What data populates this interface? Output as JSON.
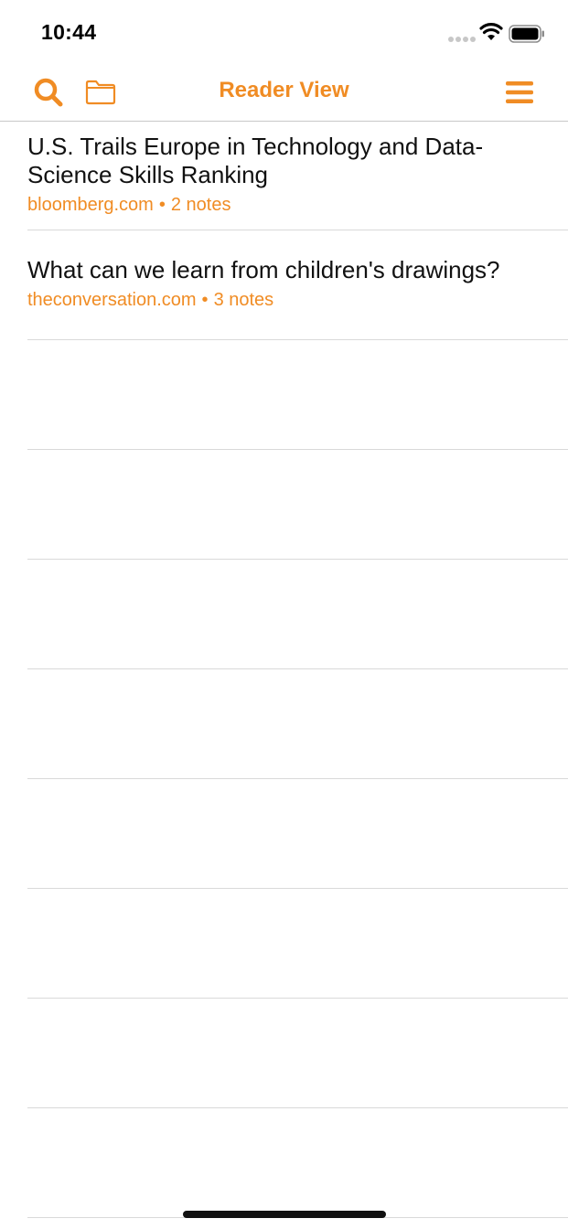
{
  "status_bar": {
    "time": "10:44"
  },
  "nav": {
    "title": "Reader View",
    "accent_color": "#f08c24",
    "left_icons": [
      "search-icon",
      "folder-icon"
    ],
    "right_icons": [
      "menu-icon"
    ]
  },
  "articles": [
    {
      "title": "U.S. Trails Europe in Technology and Data-Science Skills Ranking",
      "source": "bloomberg.com",
      "separator": "•",
      "notes": "2 notes"
    },
    {
      "title": "What can we learn from children's drawings?",
      "source": "theconversation.com",
      "separator": "•",
      "notes": "3 notes"
    }
  ]
}
